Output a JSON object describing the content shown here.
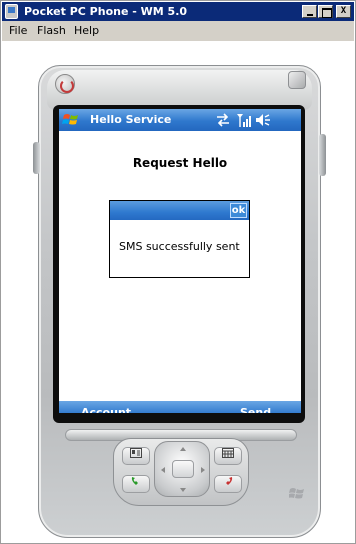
{
  "window": {
    "title": "Pocket PC Phone - WM 5.0",
    "controls": [
      "minimize",
      "maximize",
      "close"
    ],
    "close_glyph": "X"
  },
  "menubar": {
    "items": [
      "File",
      "Flash",
      "Help"
    ]
  },
  "device": {
    "status_bar": {
      "title": "Hello Service",
      "icons": [
        "connectivity-icon",
        "signal-icon",
        "volume-icon"
      ]
    },
    "content": {
      "title": "Request Hello"
    },
    "dialog": {
      "ok_label": "ok",
      "message": "SMS successfully sent"
    },
    "softkeys": {
      "left": "Account",
      "right": "Send"
    }
  },
  "colors": {
    "titlebar": "#0b2a78",
    "status_bar": "#2f78cd",
    "menubar": "#d4d0c8"
  }
}
